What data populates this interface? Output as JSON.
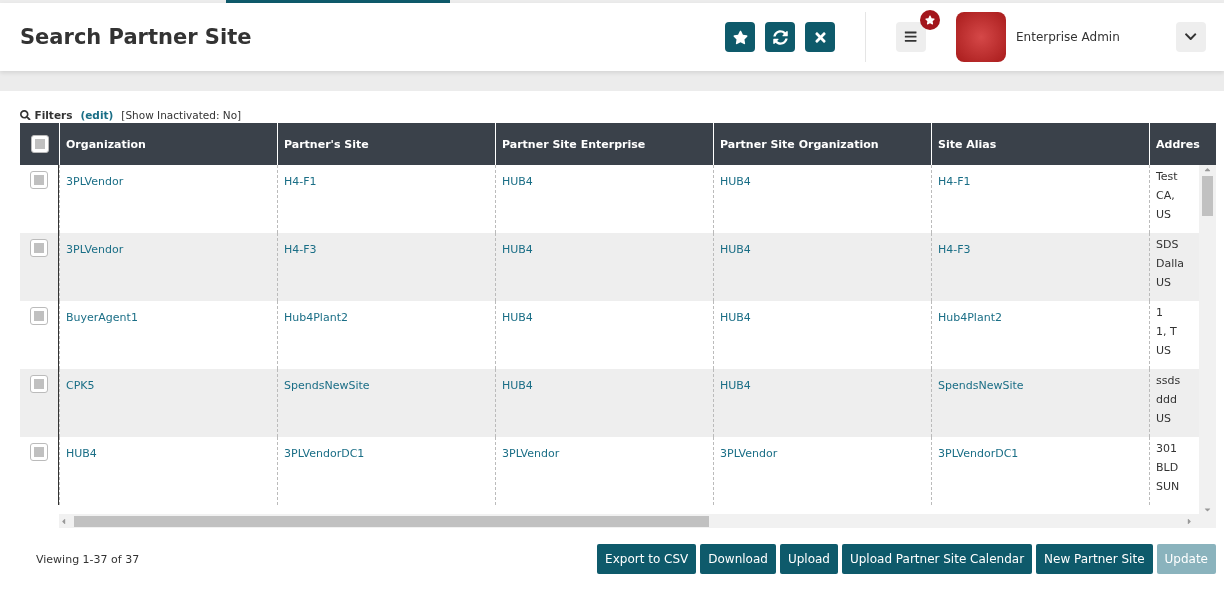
{
  "page_title": "Search Partner Site",
  "header_actions": [
    {
      "kind": "star"
    },
    {
      "kind": "refresh"
    },
    {
      "kind": "close"
    }
  ],
  "user": {
    "role": "Enterprise Admin"
  },
  "filters": {
    "label": "Filters",
    "edit": "(edit)",
    "summary": "[Show Inactivated: No]"
  },
  "table": {
    "all_checked": false,
    "columns": [
      "Organization",
      "Partner's Site",
      "Partner Site Enterprise",
      "Partner Site Organization",
      "Site Alias",
      "Addres"
    ],
    "rows": [
      {
        "checked": false,
        "cells": [
          "3PLVendor",
          "H4-F1",
          "HUB4",
          "HUB4",
          "H4-F1"
        ],
        "address": [
          "Test",
          "CA,",
          "US"
        ]
      },
      {
        "checked": false,
        "cells": [
          "3PLVendor",
          "H4-F3",
          "HUB4",
          "HUB4",
          "H4-F3"
        ],
        "address": [
          "SDS",
          "Dalla",
          "US"
        ]
      },
      {
        "checked": false,
        "cells": [
          "BuyerAgent1",
          "Hub4Plant2",
          "HUB4",
          "HUB4",
          "Hub4Plant2"
        ],
        "address": [
          "1",
          "1, T",
          "US"
        ]
      },
      {
        "checked": false,
        "cells": [
          "CPK5",
          "SpendsNewSite",
          "HUB4",
          "HUB4",
          "SpendsNewSite"
        ],
        "address": [
          "ssds",
          "ddd",
          "US"
        ]
      },
      {
        "checked": false,
        "cells": [
          "HUB4",
          "3PLVendorDC1",
          "3PLVendor",
          "3PLVendor",
          "3PLVendorDC1"
        ],
        "address": [
          "301",
          "BLD",
          "SUN"
        ]
      }
    ]
  },
  "viewing": "Viewing 1-37 of 37",
  "buttons": [
    {
      "label": "Export to CSV",
      "disabled": false
    },
    {
      "label": "Download",
      "disabled": false
    },
    {
      "label": "Upload",
      "disabled": false
    },
    {
      "label": "Upload Partner Site Calendar",
      "disabled": false
    },
    {
      "label": "New Partner Site",
      "disabled": false
    },
    {
      "label": "Update",
      "disabled": true
    }
  ]
}
